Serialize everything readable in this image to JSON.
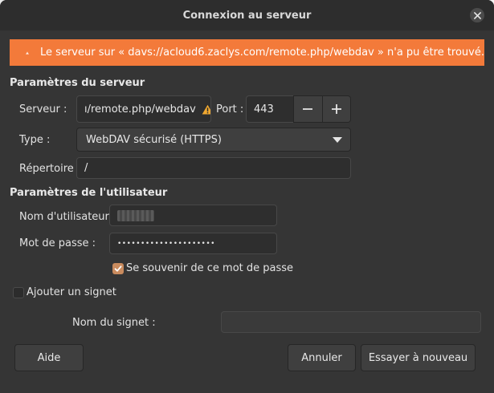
{
  "window": {
    "title": "Connexion au serveur"
  },
  "banner": {
    "message": "Le serveur sur « davs://acloud6.zaclys.com/remote.php/webdav » n'a pu être trouvé.",
    "color": "#f37a3a"
  },
  "server": {
    "section_title": "Paramètres du serveur",
    "server_label": "Serveur :",
    "server_value": "ı/remote.php/webdav",
    "port_label": "Port :",
    "port_value": "443",
    "type_label": "Type :",
    "type_value": "WebDAV sécurisé (HTTPS)",
    "dir_label": "Répertoire :",
    "dir_value": "/"
  },
  "user": {
    "section_title": "Paramètres de l'utilisateur",
    "username_label": "Nom d'utilisateur :",
    "username_value": "",
    "password_label": "Mot de passe :",
    "password_value": "•••••••••••••••••••••",
    "remember_label": "Se souvenir de ce mot de passe",
    "remember_checked": true
  },
  "bookmark": {
    "add_label": "Ajouter un signet",
    "add_checked": false,
    "name_label": "Nom du signet :",
    "name_value": ""
  },
  "buttons": {
    "help": "Aide",
    "cancel": "Annuler",
    "retry": "Essayer à nouveau"
  },
  "colors": {
    "accent": "#c98b5e",
    "warning_icon": "#f0a830"
  }
}
